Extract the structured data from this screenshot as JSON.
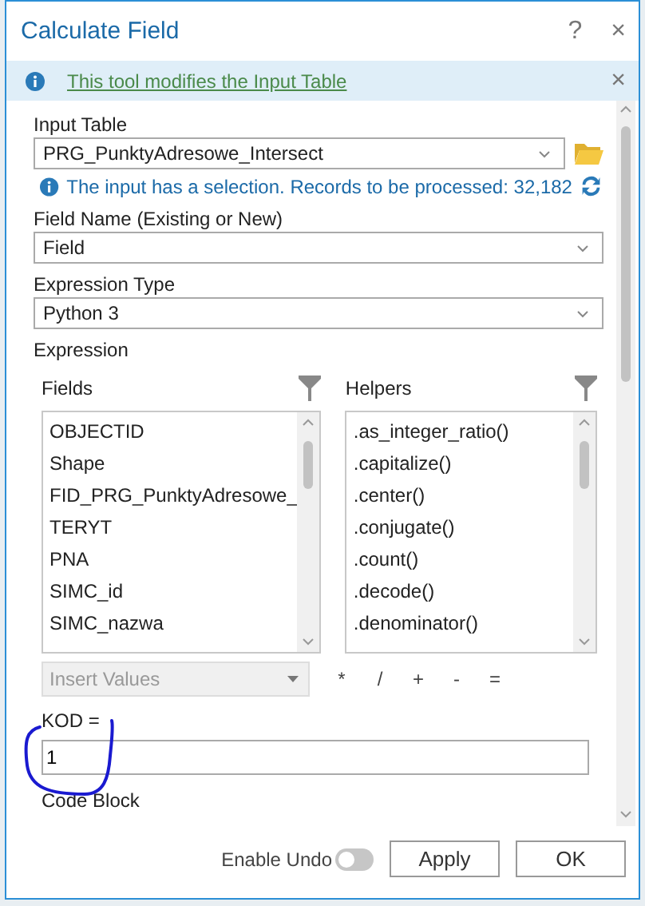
{
  "window": {
    "title": "Calculate Field",
    "help": "?",
    "close": "×"
  },
  "info_bar": {
    "text": "This tool modifies the Input Table",
    "close": "×"
  },
  "input_table": {
    "label": "Input Table",
    "value": "PRG_PunktyAdresowe_Intersect"
  },
  "selection_note": {
    "text": "The input has a selection. Records to be processed: 32,182"
  },
  "field_name": {
    "label": "Field Name (Existing or New)",
    "value": "Field"
  },
  "expression_type": {
    "label": "Expression Type",
    "value": "Python 3"
  },
  "expression": {
    "label": "Expression",
    "fields": {
      "label": "Fields",
      "items": [
        "OBJECTID",
        "Shape",
        "FID_PRG_PunktyAdresowe_",
        "TERYT",
        "PNA",
        "SIMC_id",
        "SIMC_nazwa"
      ]
    },
    "helpers": {
      "label": "Helpers",
      "items": [
        ".as_integer_ratio()",
        ".capitalize()",
        ".center()",
        ".conjugate()",
        ".count()",
        ".decode()",
        ".denominator()"
      ]
    },
    "insert_values": {
      "placeholder": "Insert Values",
      "disabled": true
    },
    "operators": [
      "*",
      "/",
      "+",
      "-",
      "="
    ],
    "target_label": "KOD =",
    "value": "1"
  },
  "code_block": {
    "label": "Code Block"
  },
  "footer": {
    "enable_undo": {
      "label": "Enable Undo",
      "on": false
    },
    "buttons": [
      "Apply",
      "OK"
    ]
  }
}
